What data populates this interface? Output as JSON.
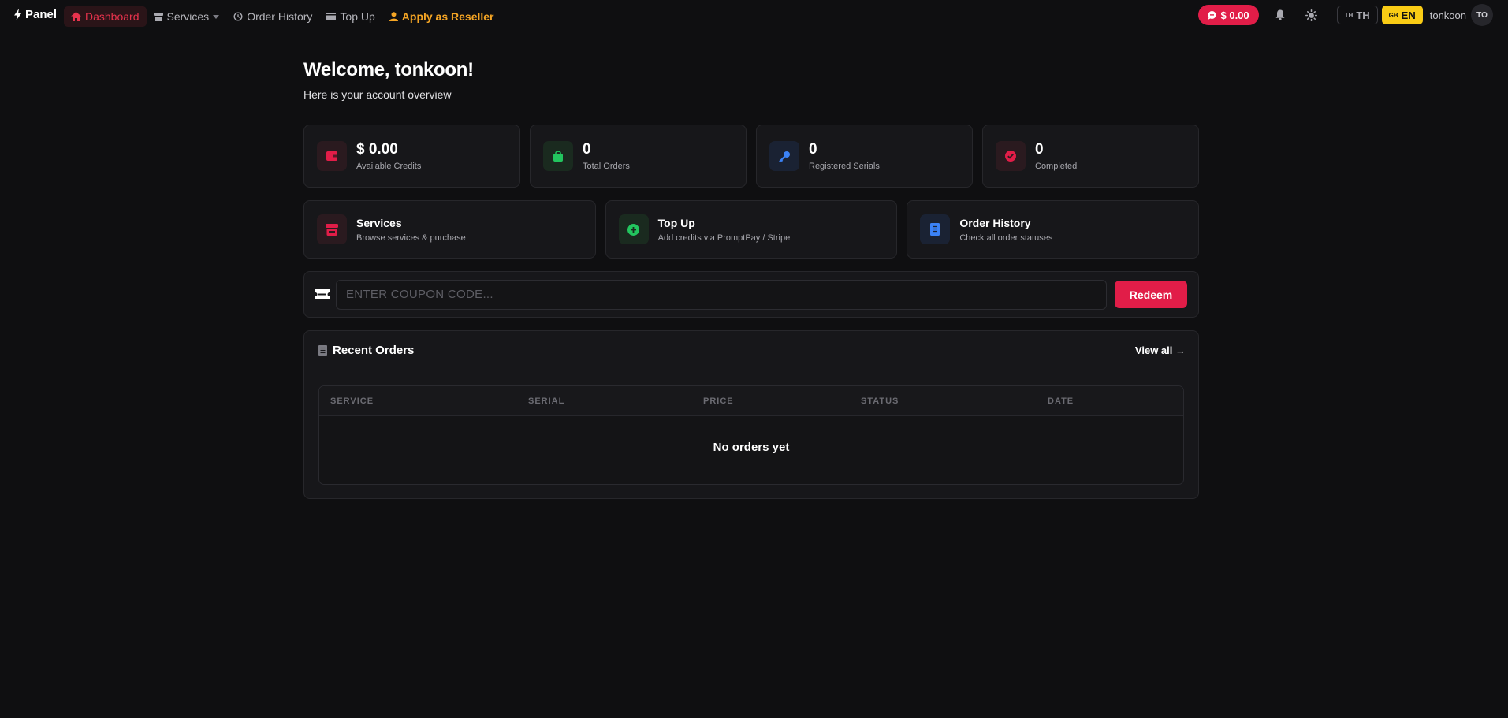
{
  "nav": {
    "brand": "Panel",
    "links": [
      {
        "label": "Dashboard"
      },
      {
        "label": "Services"
      },
      {
        "label": "Order History"
      },
      {
        "label": "Top Up"
      },
      {
        "label": "Apply as Reseller"
      }
    ],
    "credit": "$ 0.00",
    "lang_th": {
      "code": "TH",
      "label": "TH"
    },
    "lang_en": {
      "code": "GB",
      "label": "EN"
    },
    "username": "tonkoon",
    "avatar_initials": "TO"
  },
  "main": {
    "welcome": "Welcome, tonkoon!",
    "subtitle": "Here is your account overview",
    "stats": [
      {
        "value": "$ 0.00",
        "label": "Available Credits",
        "icon": "wallet-icon",
        "color": "#e11d48"
      },
      {
        "value": "0",
        "label": "Total Orders",
        "icon": "shopping-bag-icon",
        "color": "#22c55e"
      },
      {
        "value": "0",
        "label": "Registered Serials",
        "icon": "key-icon",
        "color": "#3b82f6"
      },
      {
        "value": "0",
        "label": "Completed",
        "icon": "check-circle-icon",
        "color": "#e11d48"
      }
    ],
    "quick": [
      {
        "title": "Services",
        "desc": "Browse services & purchase",
        "icon": "store-icon"
      },
      {
        "title": "Top Up",
        "desc": "Add credits via PromptPay / Stripe",
        "icon": "plus-circle-icon"
      },
      {
        "title": "Order History",
        "desc": "Check all order statuses",
        "icon": "document-icon"
      }
    ],
    "coupon": {
      "placeholder": "ENTER COUPON CODE...",
      "button": "Redeem"
    },
    "orders": {
      "title": "Recent Orders",
      "view_all": "View all →",
      "columns": [
        "SERVICE",
        "SERIAL",
        "PRICE",
        "STATUS",
        "DATE"
      ],
      "empty": "No orders yet"
    }
  },
  "colors": {
    "accent": "#e11d48",
    "reseller": "#f5a524",
    "lang_active": "#facc15"
  }
}
